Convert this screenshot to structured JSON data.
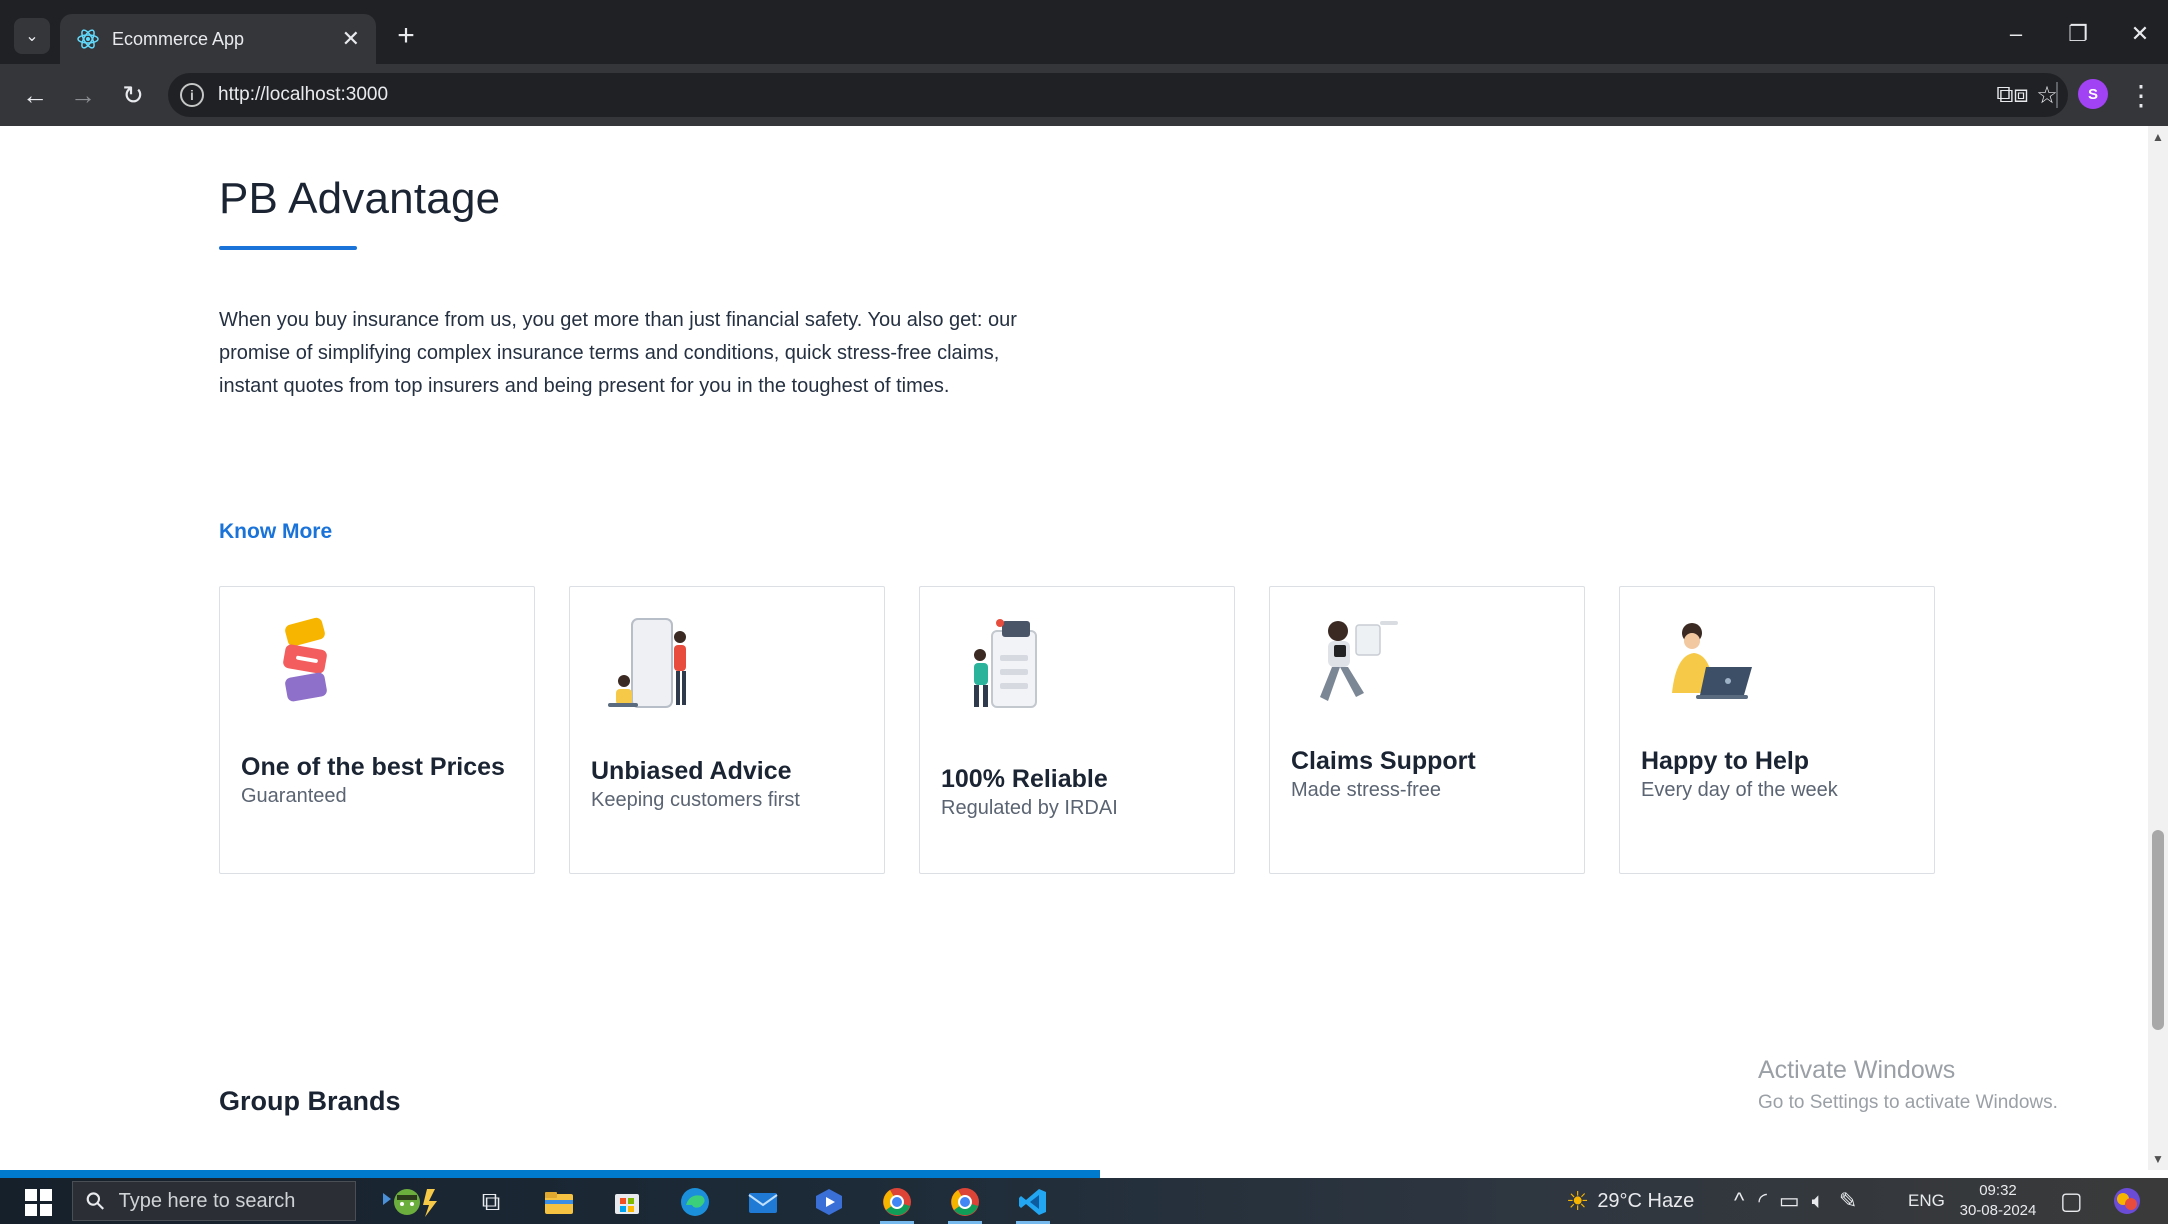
{
  "browser": {
    "tab_title": "Ecommerce App",
    "url": "http://localhost:3000",
    "avatar_letter": "S"
  },
  "page": {
    "title": "PB Advantage",
    "intro": "When you buy insurance from us, you get more than just financial safety. You also get: our promise of simplifying complex insurance terms and conditions, quick stress-free claims, instant quotes from top insurers and being present for you in the toughest of times.",
    "know_more": "Know More",
    "cards": [
      {
        "title": "One of the best Prices",
        "subtitle": "Guaranteed"
      },
      {
        "title": "Unbiased Advice",
        "subtitle": "Keeping customers first"
      },
      {
        "title": "100% Reliable",
        "subtitle": "Regulated by IRDAI"
      },
      {
        "title": "Claims Support",
        "subtitle": "Made stress-free"
      },
      {
        "title": "Happy to Help",
        "subtitle": "Every day of the week"
      }
    ],
    "group_brands": "Group Brands"
  },
  "watermark": {
    "title": "Activate Windows",
    "subtitle": "Go to Settings to activate Windows."
  },
  "taskbar": {
    "search_placeholder": "Type here to search",
    "weather": "29°C  Haze",
    "language": "ENG",
    "time": "09:32",
    "date": "30-08-2024"
  },
  "colors": {
    "accent": "#1a73d9",
    "heading": "#1b2433",
    "card_border": "#dcdfe4"
  }
}
